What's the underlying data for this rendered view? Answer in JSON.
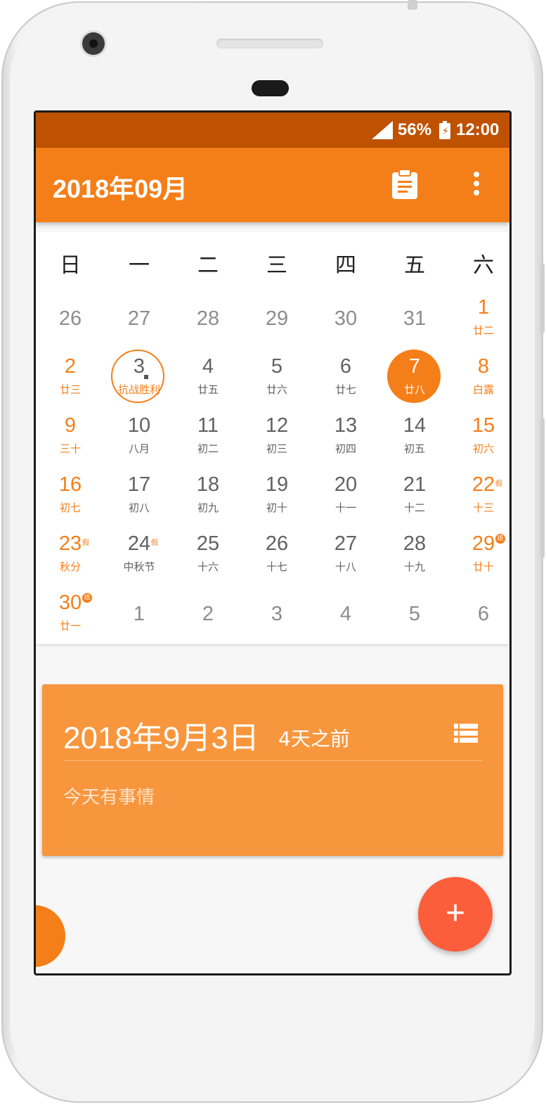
{
  "status": {
    "battery": "56%",
    "time": "12:00"
  },
  "appbar": {
    "title": "2018年09月",
    "clipboard_icon": "clipboard-icon",
    "more_icon": "more-vert-icon"
  },
  "colors": {
    "primary": "#f47f19",
    "status_bar": "#bf5200",
    "card": "#f8963d",
    "fab": "#fc5e3c",
    "text_gray": "#616161"
  },
  "calendar": {
    "weekdays": [
      "日",
      "一",
      "二",
      "三",
      "四",
      "五",
      "六"
    ],
    "weeks": [
      [
        {
          "n": "26",
          "o": true
        },
        {
          "n": "27",
          "o": true
        },
        {
          "n": "28",
          "o": true
        },
        {
          "n": "29",
          "o": true
        },
        {
          "n": "30",
          "o": true
        },
        {
          "n": "31",
          "o": true
        },
        {
          "n": "1",
          "s": "廿二",
          "w": true
        }
      ],
      [
        {
          "n": "2",
          "s": "廿三",
          "w": true
        },
        {
          "n": "3",
          "s": "抗战胜利",
          "today": true
        },
        {
          "n": "4",
          "s": "廿五"
        },
        {
          "n": "5",
          "s": "廿六"
        },
        {
          "n": "6",
          "s": "廿七"
        },
        {
          "n": "7",
          "s": "廿八",
          "selected": true
        },
        {
          "n": "8",
          "s": "白露",
          "w": true
        }
      ],
      [
        {
          "n": "9",
          "s": "三十",
          "w": true
        },
        {
          "n": "10",
          "s": "八月"
        },
        {
          "n": "11",
          "s": "初二"
        },
        {
          "n": "12",
          "s": "初三"
        },
        {
          "n": "13",
          "s": "初四"
        },
        {
          "n": "14",
          "s": "初五"
        },
        {
          "n": "15",
          "s": "初六",
          "w": true
        }
      ],
      [
        {
          "n": "16",
          "s": "初七",
          "w": true
        },
        {
          "n": "17",
          "s": "初八"
        },
        {
          "n": "18",
          "s": "初九"
        },
        {
          "n": "19",
          "s": "初十"
        },
        {
          "n": "20",
          "s": "十一"
        },
        {
          "n": "21",
          "s": "十二"
        },
        {
          "n": "22",
          "s": "十三",
          "w": true,
          "b": "假"
        }
      ],
      [
        {
          "n": "23",
          "s": "秋分",
          "w": true,
          "b": "假"
        },
        {
          "n": "24",
          "s": "中秋节",
          "b": "假"
        },
        {
          "n": "25",
          "s": "十六"
        },
        {
          "n": "26",
          "s": "十七"
        },
        {
          "n": "27",
          "s": "十八"
        },
        {
          "n": "28",
          "s": "十九"
        },
        {
          "n": "29",
          "s": "廿十",
          "w": true,
          "b": "班",
          "bc": true
        }
      ],
      [
        {
          "n": "30",
          "s": "廿一",
          "w": true,
          "b": "班",
          "bc": true
        },
        {
          "n": "1",
          "o": true
        },
        {
          "n": "2",
          "o": true
        },
        {
          "n": "3",
          "o": true
        },
        {
          "n": "4",
          "o": true
        },
        {
          "n": "5",
          "o": true
        },
        {
          "n": "6",
          "o": true
        }
      ]
    ]
  },
  "event_card": {
    "date": "2018年9月3日",
    "relative": "4天之前",
    "note": "今天有事情",
    "list_icon": "list-icon"
  },
  "fab": {
    "label": "+",
    "icon": "add-icon"
  }
}
